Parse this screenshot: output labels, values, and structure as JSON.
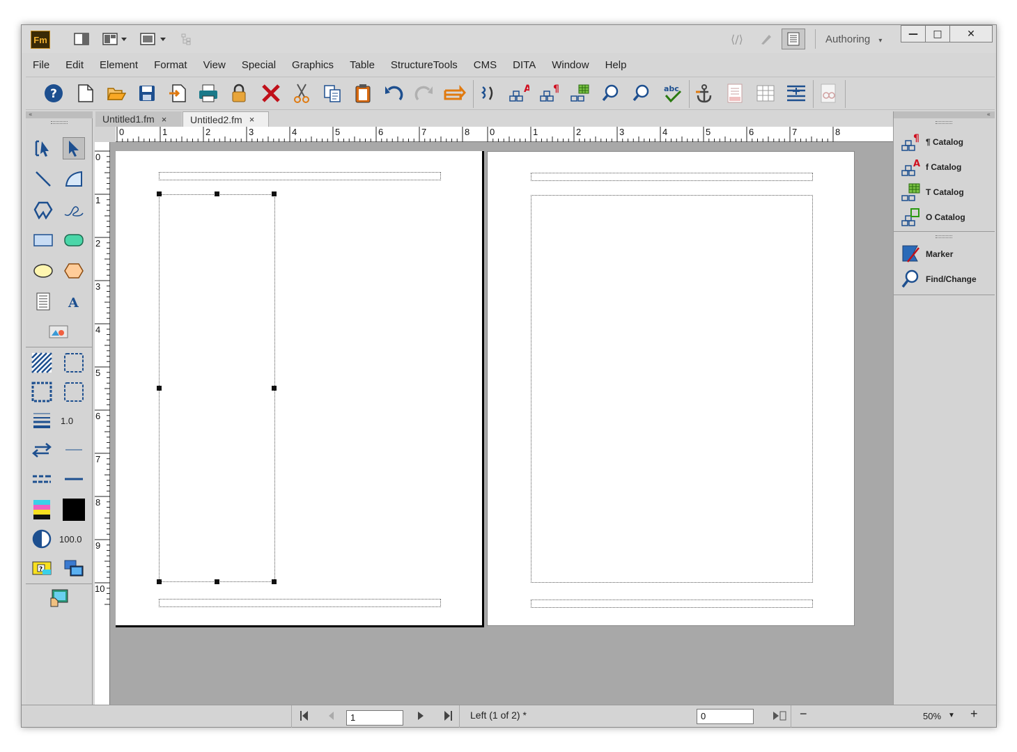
{
  "app": {
    "logo": "Fm",
    "workspace": "Authoring",
    "workspace_arrow": "▾"
  },
  "window_buttons": {
    "minimize": "—",
    "maximize": "□",
    "close": "✕"
  },
  "menu": [
    "File",
    "Edit",
    "Element",
    "Format",
    "View",
    "Special",
    "Graphics",
    "Table",
    "StructureTools",
    "CMS",
    "DITA",
    "Window",
    "Help"
  ],
  "tabs": [
    {
      "label": "Untitled1.fm",
      "close": "×"
    },
    {
      "label": "Untitled2.fm",
      "close": "×"
    }
  ],
  "ruler": {
    "h_left": [
      "0",
      "1",
      "2",
      "3",
      "4",
      "5",
      "6",
      "7",
      "8"
    ],
    "h_right": [
      "0",
      "1",
      "2",
      "3",
      "4",
      "5",
      "6",
      "7",
      "8"
    ],
    "v": [
      "0",
      "1",
      "2",
      "3",
      "4",
      "5",
      "6",
      "7",
      "8",
      "9",
      "10"
    ]
  },
  "left_tools": {
    "line_width": "1.0",
    "tint": "100.0"
  },
  "right_panel": {
    "items": [
      {
        "icon": "paragraph-catalog-icon",
        "label": "¶ Catalog"
      },
      {
        "icon": "character-catalog-icon",
        "label": "f Catalog"
      },
      {
        "icon": "table-catalog-icon",
        "label": "T Catalog"
      },
      {
        "icon": "object-catalog-icon",
        "label": "O Catalog"
      },
      {
        "icon": "marker-icon",
        "label": "Marker"
      },
      {
        "icon": "find-change-icon",
        "label": "Find/Change"
      }
    ]
  },
  "status": {
    "page_number": "1",
    "page_label": "Left (1 of 2) *",
    "value_field": "0",
    "zoom": "50%",
    "zoom_minus": "−",
    "zoom_plus": "+"
  },
  "colors": {
    "chrome": "#d6d6d6",
    "pasteboard": "#a8a8a8",
    "toolbar_red": "#c0101a",
    "toolbar_blue": "#1a5fa8",
    "toolbar_orange": "#e07a10"
  }
}
